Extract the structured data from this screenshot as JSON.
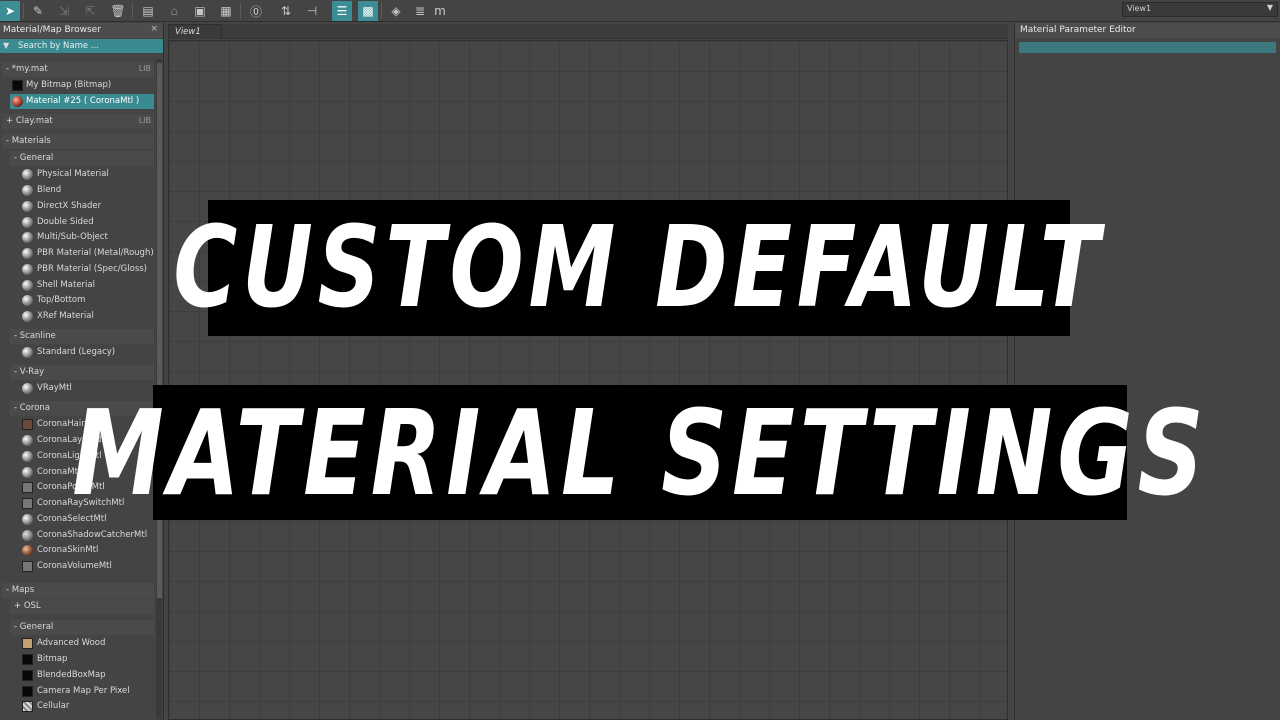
{
  "toolbar": {
    "view_dropdown": "View1",
    "icons": [
      "select-arrow-icon",
      "eyedropper-icon",
      "pick-material-icon",
      "assign-material-icon",
      "delete-icon",
      "layout-icon",
      "move-children-icon",
      "box-icon",
      "checker-icon",
      "zero-icon",
      "layout-children-icon",
      "navigator-icon",
      "layout-list-icon",
      "background-checker-icon",
      "select-node-icon",
      "layers-icon",
      "m-icon"
    ]
  },
  "browser": {
    "title": "Material/Map Browser",
    "close": "×",
    "search_placeholder": "Search by Name ...",
    "libraries": [
      {
        "toggle": "-",
        "name": "*my.mat",
        "tag": "LIB"
      },
      {
        "toggle": "+",
        "name": "Clay.mat",
        "tag": "LIB"
      }
    ],
    "lib_items": [
      "My Bitmap (Bitmap)",
      "Material #25  ( CoronaMtl )"
    ],
    "materials_header": "- Materials",
    "groups": {
      "general": "- General",
      "scanline": "- Scanline",
      "vray": "- V-Ray",
      "corona": "- Corona"
    },
    "general_items": [
      "Physical Material",
      "Blend",
      "DirectX Shader",
      "Double Sided",
      "Multi/Sub-Object",
      "PBR Material (Metal/Rough)",
      "PBR Material (Spec/Gloss)",
      "Shell Material",
      "Top/Bottom",
      "XRef Material"
    ],
    "scanline_items": [
      "Standard (Legacy)"
    ],
    "vray_items": [
      "VRayMtl"
    ],
    "corona_items": [
      "CoronaHairMtl",
      "CoronaLayeredMtl",
      "CoronaLightMtl",
      "CoronaMtl",
      "CoronaPortalMtl",
      "CoronaRaySwitchMtl",
      "CoronaSelectMtl",
      "CoronaShadowCatcherMtl",
      "CoronaSkinMtl",
      "CoronaVolumeMtl"
    ],
    "maps_header": "- Maps",
    "osl": "+ OSL",
    "maps_general": "- General",
    "maps_items": [
      "Advanced Wood",
      "Bitmap",
      "BlendedBoxMap",
      "Camera Map Per Pixel",
      "Cellular"
    ]
  },
  "view": {
    "tab": "View1"
  },
  "param_editor": {
    "title": "Material Parameter Editor"
  },
  "overlay": {
    "line1": "CUSTOM DEFAULT",
    "line2": "MATERIAL SETTINGS"
  },
  "colors": {
    "accent": "#3a8a91",
    "panel": "#444444",
    "banner_bg": "#000000",
    "banner_text": "#ffffff"
  }
}
